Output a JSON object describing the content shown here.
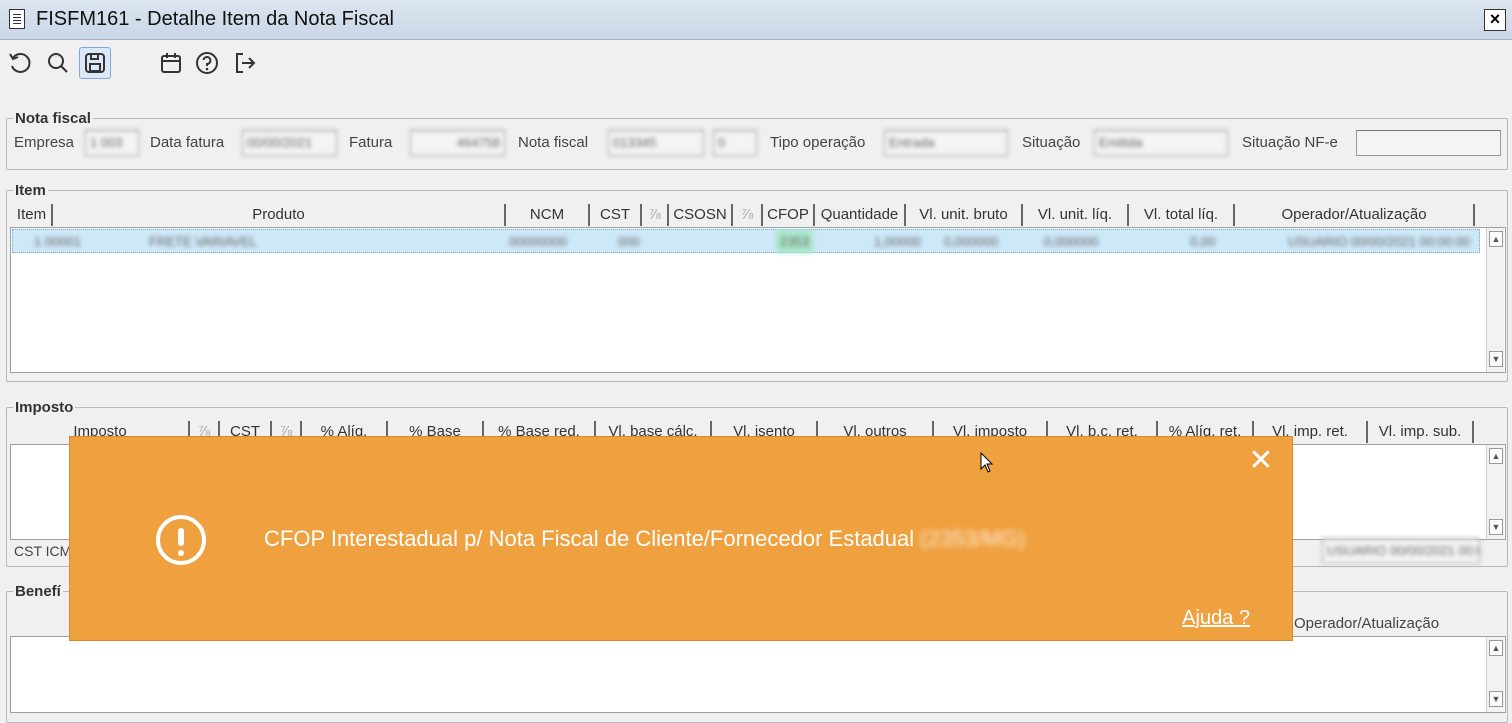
{
  "window": {
    "title": "FISFM161 - Detalhe Item da Nota Fiscal",
    "close": "×"
  },
  "toolbar": {
    "icons": [
      "undo-icon",
      "search-icon",
      "save-icon",
      "calendar-icon",
      "help-icon",
      "exit-icon"
    ]
  },
  "nota_fiscal": {
    "legend": "Nota fiscal",
    "empresa_label": "Empresa",
    "empresa_value": "1 003",
    "data_fatura_label": "Data fatura",
    "data_fatura_value": "00/00/2021",
    "fatura_label": "Fatura",
    "fatura_value": "464758",
    "nota_label": "Nota fiscal",
    "nota_value": "013345",
    "nota_serie": "0",
    "tipo_label": "Tipo operação",
    "tipo_value": "Entrada",
    "situacao_label": "Situação",
    "situacao_value": "Emitida",
    "situacao_nfe_label": "Situação NF-e",
    "situacao_nfe_value": ""
  },
  "item": {
    "legend": "Item",
    "columns": [
      "Item",
      "Produto",
      "NCM",
      "CST",
      "⅞",
      "CSOSN",
      "⅞",
      "CFOP",
      "Quantidade",
      "Vl. unit. bruto",
      "Vl. unit. líq.",
      "Vl. total líq.",
      "Operador/Atualização"
    ],
    "row": [
      "1 00001",
      "FRETE VARIAVEL",
      "00000000",
      "000",
      "",
      "",
      "",
      "2353",
      "1,00000",
      "0,000000",
      "0,000000",
      "0,00",
      "USUARIO 00/00/2021 00:00:00"
    ]
  },
  "imposto": {
    "legend": "Imposto",
    "columns": [
      "Imposto",
      "⅞",
      "CST",
      "⅞",
      "% Alíq.",
      "% Base",
      "% Base red.",
      "Vl. base cálc.",
      "Vl. isento",
      "Vl. outros",
      "Vl. imposto",
      "Vl. b.c. ret.",
      "% Alíq. ret.",
      "Vl. imp. ret.",
      "Vl. imp. sub."
    ],
    "cst_icms_label": "CST ICM",
    "right_value": "USUARIO 00/00/2021 00:00:00"
  },
  "beneficio": {
    "legend": "Benefí",
    "operator_col": "Operador/Atualização"
  },
  "toast": {
    "message": "CFOP Interestadual p/ Nota Fiscal de Cliente/Fornecedor Estadual",
    "message_blur": "(2353/MG)",
    "help": "Ajuda ?",
    "close": "✕"
  }
}
